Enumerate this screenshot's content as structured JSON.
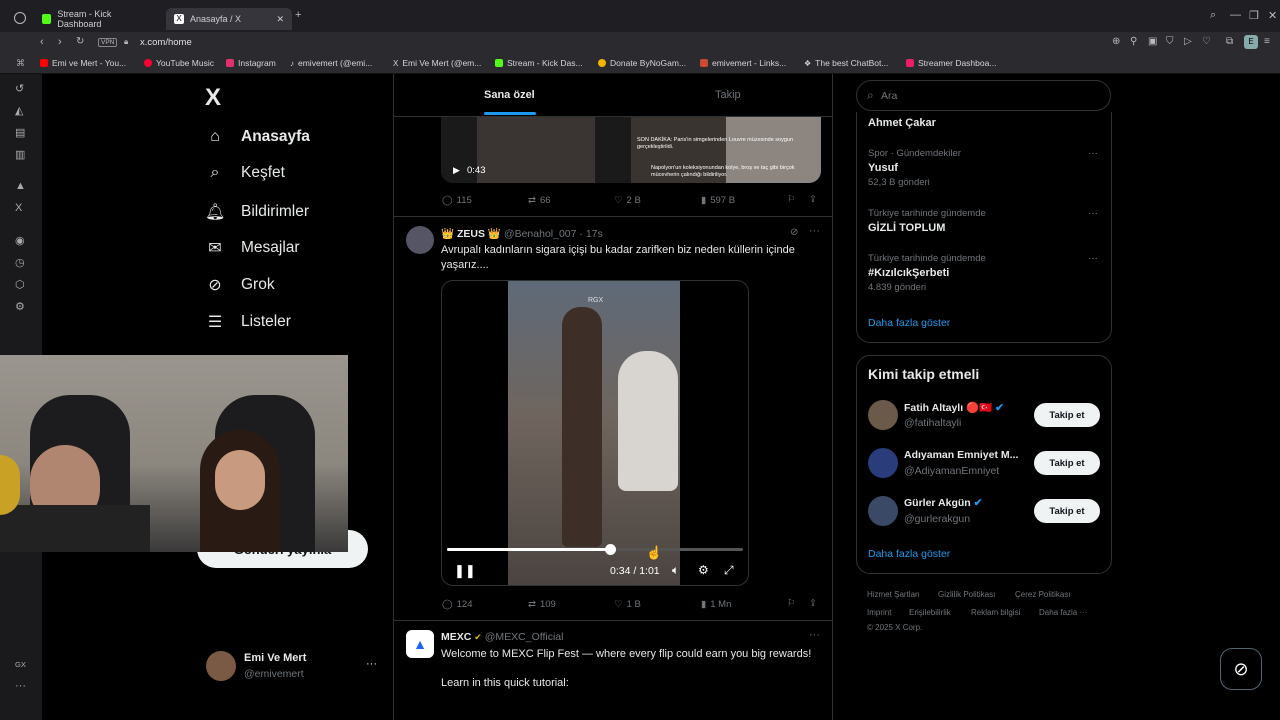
{
  "browser": {
    "tabs": [
      {
        "label": "Stream - Kick Dashboard",
        "favicon_color": "#53fc18"
      },
      {
        "label": "Anasayfa / X",
        "favicon_color": "#ffffff"
      }
    ],
    "vpn_label": "VPN",
    "url": "x.com/home",
    "bookmarks": [
      {
        "label": "Emi ve Mert - You...",
        "color": "#ff0000"
      },
      {
        "label": "YouTube Music",
        "color": "#ff0033"
      },
      {
        "label": "Instagram",
        "color": "#e1306c"
      },
      {
        "label": "emivemert (@emi...",
        "color": "#ffffff"
      },
      {
        "label": "Emi Ve Mert (@em...",
        "color": "#ffffff"
      },
      {
        "label": "Stream - Kick Das...",
        "color": "#53fc18"
      },
      {
        "label": "Donate ByNoGam...",
        "color": "#f2b600"
      },
      {
        "label": "emivemert - Links...",
        "color": "#c84b31"
      },
      {
        "label": "The best ChatBot...",
        "color": "#ffffff"
      },
      {
        "label": "Streamer Dashboa...",
        "color": "#e91e63"
      }
    ],
    "rail_bottom_label": "GX"
  },
  "nav": {
    "logo": "X",
    "items": [
      {
        "label": "Anasayfa",
        "icon": "home-icon",
        "glyph": "⌂"
      },
      {
        "label": "Keşfet",
        "icon": "search-icon",
        "glyph": "⌕"
      },
      {
        "label": "Bildirimler",
        "icon": "bell-icon",
        "glyph": "🔔︎"
      },
      {
        "label": "Mesajlar",
        "icon": "mail-icon",
        "glyph": "✉"
      },
      {
        "label": "Grok",
        "icon": "grok-icon",
        "glyph": "⊘"
      },
      {
        "label": "Listeler",
        "icon": "list-icon",
        "glyph": "☰"
      }
    ],
    "post_button": "Gönderi yayınla",
    "profile": {
      "name": "Emi Ve Mert",
      "handle": "@emivemert"
    }
  },
  "feed": {
    "tabs": [
      "Sana özel",
      "Takip"
    ],
    "post1": {
      "video_time": "0:43",
      "news_text": "SON DAKİKA: Paris'in simgelerinden Louvre müzesinde soygun gerçekleştirildi.",
      "news_text2": "Napolyon'un koleksiyonundan kolye, broş ve taç gibi birçok mücevherin çalındığı bildiriliyor.",
      "stats": {
        "replies": "115",
        "reposts": "66",
        "likes": "2 B",
        "views": "597 B"
      }
    },
    "post2": {
      "author": "👑 ZEUS 👑",
      "handle": "@Benahol_007",
      "time": "· 17s",
      "text": "Avrupalı kadınların sigara içişi bu kadar  zarifken  biz neden küllerin içinde yaşarız....",
      "watermark": "RGX",
      "video_time": "0:34 / 1:01",
      "progress": 0.55,
      "stats": {
        "replies": "124",
        "reposts": "109",
        "likes": "1 B",
        "views": "1 Mn"
      }
    },
    "post3": {
      "author": "MEXC",
      "handle": "@MEXC_Official",
      "text": "Welcome to MEXC Flip Fest — where every flip could earn you big rewards!",
      "text2": "Learn in this quick tutorial:"
    }
  },
  "right": {
    "search_placeholder": "Ara",
    "trends": [
      {
        "category": "",
        "name": "Ahmet Çakar",
        "count": ""
      },
      {
        "category": "Spor · Gündemdekiler",
        "name": "Yusuf",
        "count": "52,3 B gönderi"
      },
      {
        "category": "Türkiye tarihinde gündemde",
        "name": "GİZLİ TOPLUM",
        "count": ""
      },
      {
        "category": "Türkiye tarihinde gündemde",
        "name": "#KızılcıkŞerbeti",
        "count": "4.839 gönderi"
      }
    ],
    "show_more": "Daha fazla göster",
    "who_to_follow": {
      "title": "Kimi takip etmeli",
      "users": [
        {
          "name": "Fatih Altaylı 🔴🇹🇷",
          "handle": "@fatihaltayli"
        },
        {
          "name": "Adıyaman Emniyet M...",
          "handle": "@AdiyamanEmniyet"
        },
        {
          "name": "Gürler Akgün",
          "handle": "@gurlerakgun"
        }
      ],
      "follow_label": "Takip et",
      "show_more": "Daha fazla göster"
    },
    "footer": [
      "Hizmet Şartları",
      "Gizlilik Politikası",
      "Çerez Politikası",
      "Imprint",
      "Erişilebilirlik",
      "Reklam bilgisi",
      "Daha fazla ···",
      "© 2025 X Corp."
    ]
  }
}
